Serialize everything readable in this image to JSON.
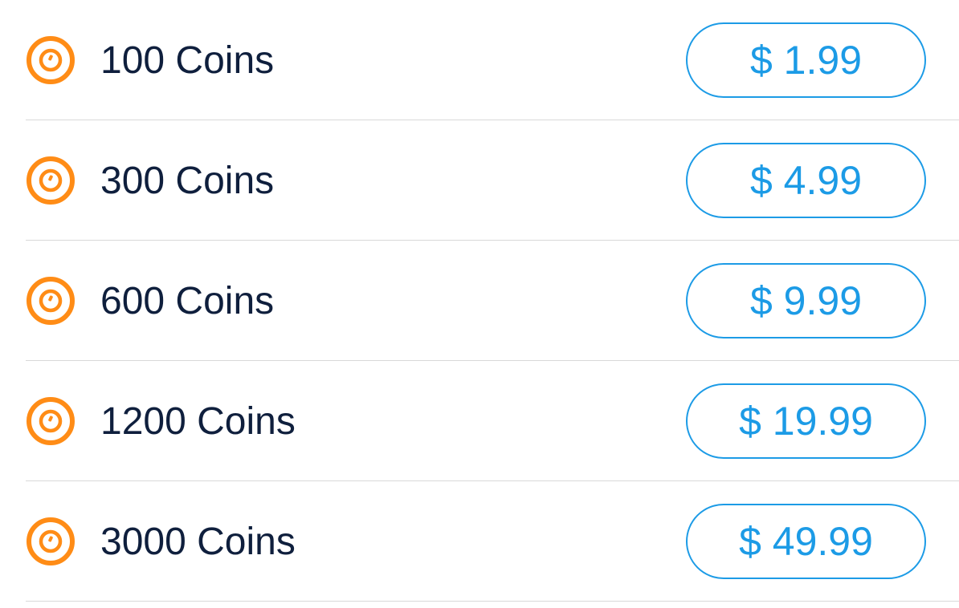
{
  "colors": {
    "coin_icon": "#ff8c16",
    "label_text": "#0f1f3d",
    "price_accent": "#1c9be6",
    "divider": "#d9d9d9"
  },
  "items": [
    {
      "label": "100 Coins",
      "price": "$ 1.99",
      "icon": "coin-icon"
    },
    {
      "label": "300 Coins",
      "price": "$ 4.99",
      "icon": "coin-icon"
    },
    {
      "label": "600 Coins",
      "price": "$ 9.99",
      "icon": "coin-icon"
    },
    {
      "label": "1200 Coins",
      "price": "$ 19.99",
      "icon": "coin-icon"
    },
    {
      "label": "3000 Coins",
      "price": "$ 49.99",
      "icon": "coin-icon"
    }
  ]
}
